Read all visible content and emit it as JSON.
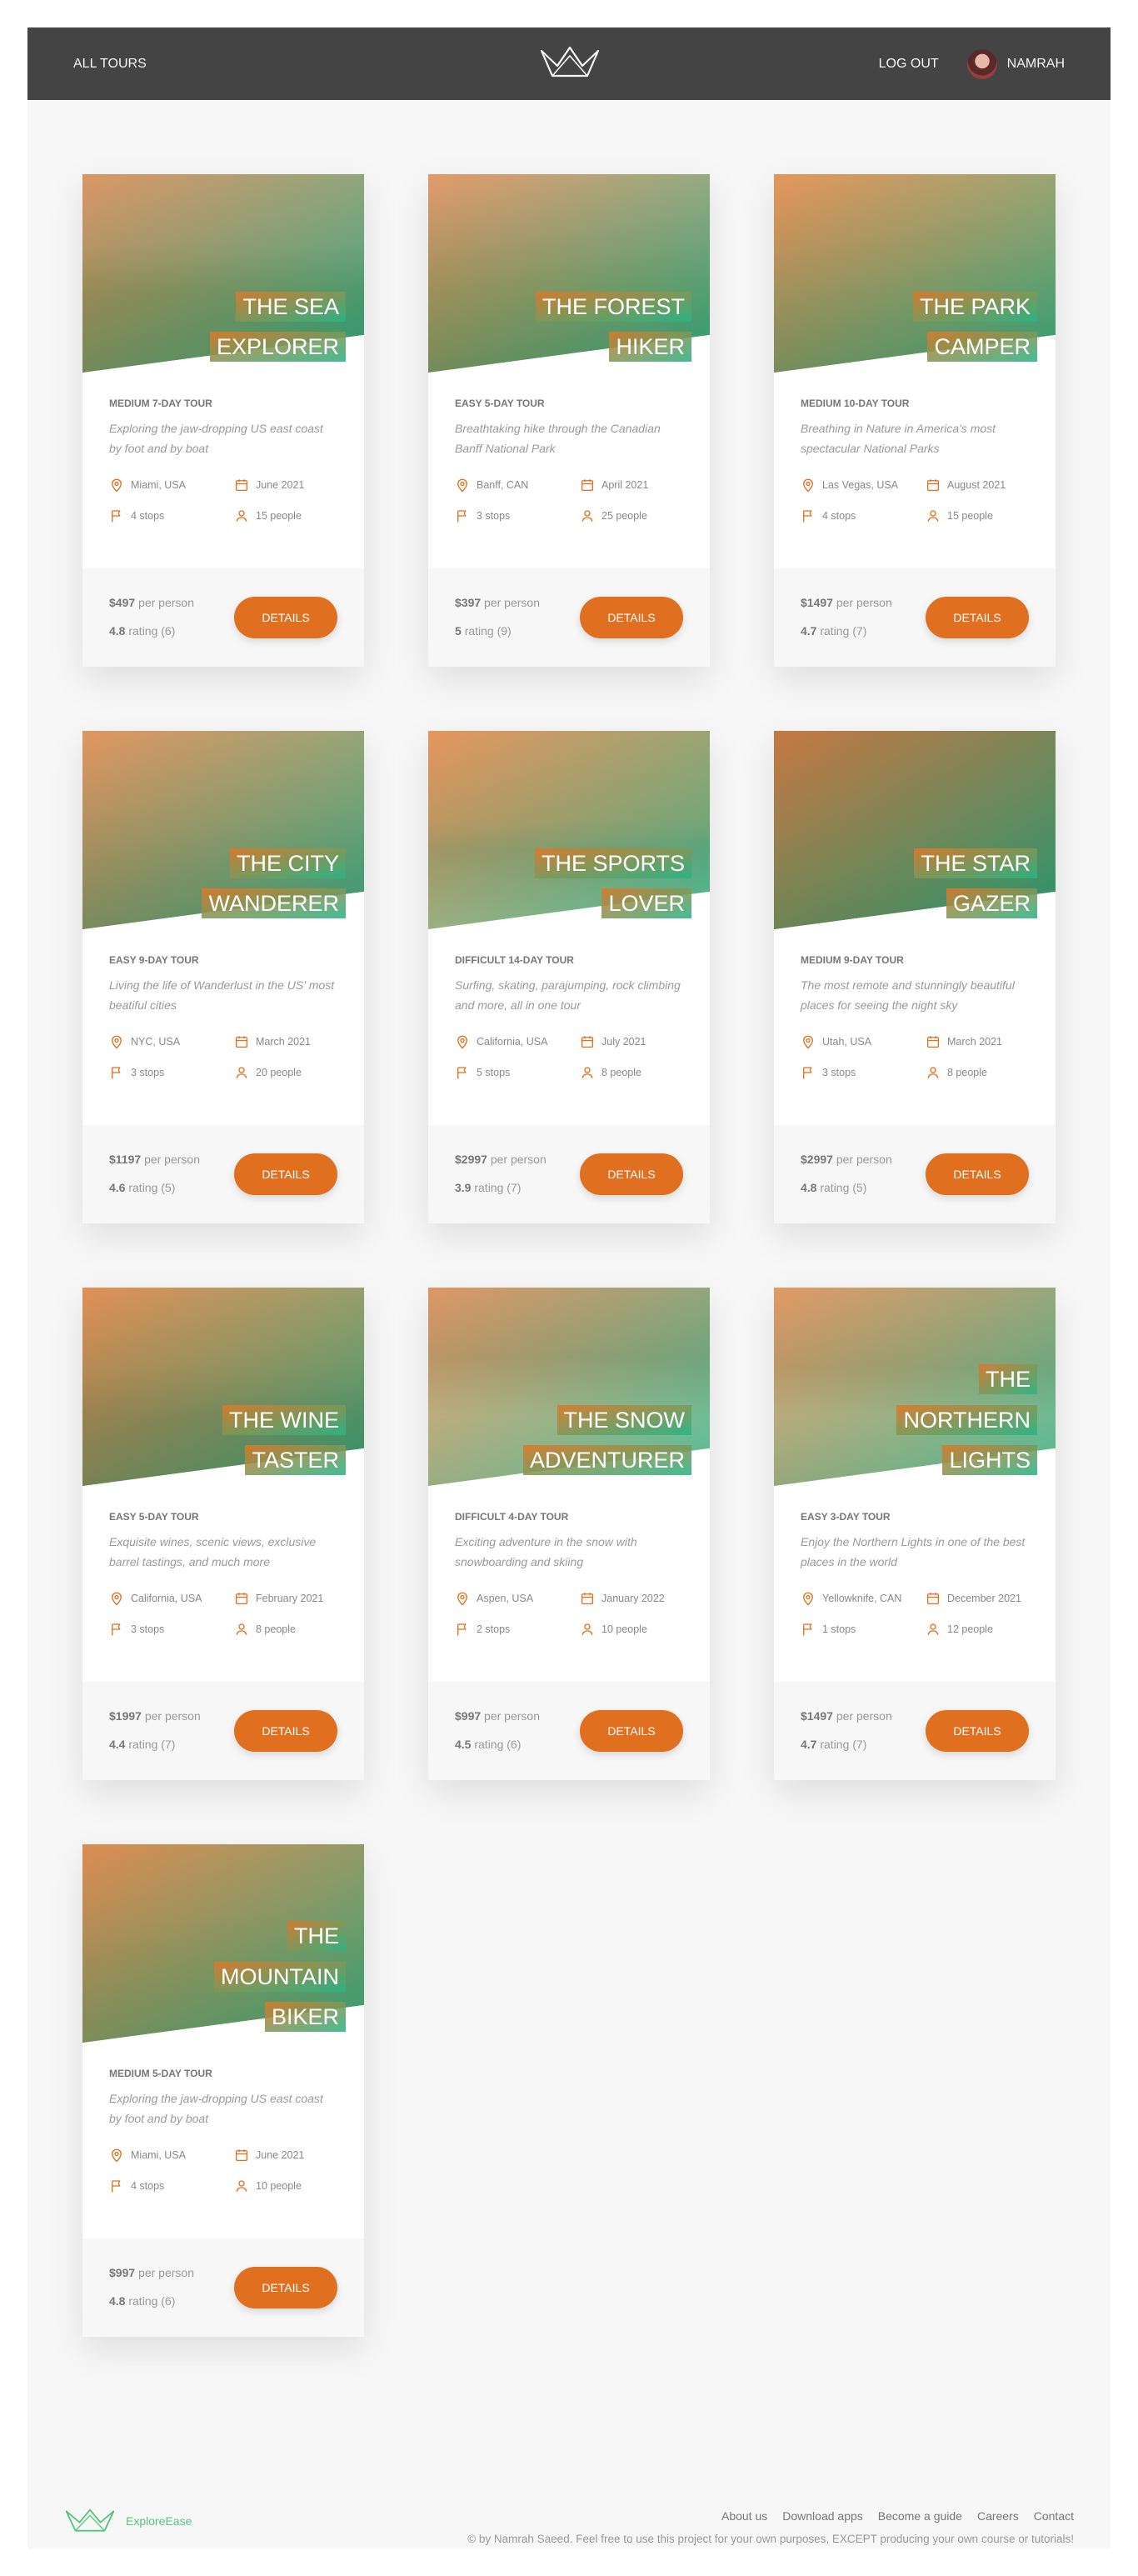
{
  "header": {
    "all_tours": "All tours",
    "logout": "Log out",
    "user_name": "NAMRAH",
    "logo_icon": "crown-logo-icon"
  },
  "colors": {
    "accent": "#e06f1f",
    "green": "#28b485",
    "header_bg": "#444444",
    "page_bg": "#f7f7f7"
  },
  "tours": [
    {
      "title": "The Sea Explorer",
      "title_lines": [
        "THE SEA",
        "EXPLORER"
      ],
      "difficulty_duration": "MEDIUM 7-DAY TOUR",
      "summary": "Exploring the jaw-dropping US east coast by foot and by boat",
      "location": "Miami, USA",
      "date": "June 2021",
      "stops": "4 stops",
      "people": "15 people",
      "price": "$497",
      "price_unit": "per person",
      "rating": "4.8",
      "rating_label": "rating (6)",
      "button": "DETAILS",
      "img_theme": "sea"
    },
    {
      "title": "The Forest Hiker",
      "title_lines": [
        "THE FOREST",
        "HIKER"
      ],
      "difficulty_duration": "EASY 5-DAY TOUR",
      "summary": "Breathtaking hike through the Canadian Banff National Park",
      "location": "Banff, CAN",
      "date": "April 2021",
      "stops": "3 stops",
      "people": "25 people",
      "price": "$397",
      "price_unit": "per person",
      "rating": "5",
      "rating_label": "rating (9)",
      "button": "DETAILS",
      "img_theme": "forest"
    },
    {
      "title": "The Park Camper",
      "title_lines": [
        "THE PARK",
        "CAMPER"
      ],
      "difficulty_duration": "MEDIUM 10-DAY TOUR",
      "summary": "Breathing in Nature in America's most spectacular National Parks",
      "location": "Las Vegas, USA",
      "date": "August 2021",
      "stops": "4 stops",
      "people": "15 people",
      "price": "$1497",
      "price_unit": "per person",
      "rating": "4.7",
      "rating_label": "rating (7)",
      "button": "DETAILS",
      "img_theme": "park"
    },
    {
      "title": "The City Wanderer",
      "title_lines": [
        "THE CITY",
        "WANDERER"
      ],
      "difficulty_duration": "EASY 9-DAY TOUR",
      "summary": "Living the life of Wanderlust in the US' most beatiful cities",
      "location": "NYC, USA",
      "date": "March 2021",
      "stops": "3 stops",
      "people": "20 people",
      "price": "$1197",
      "price_unit": "per person",
      "rating": "4.6",
      "rating_label": "rating (5)",
      "button": "DETAILS",
      "img_theme": "city"
    },
    {
      "title": "The Sports Lover",
      "title_lines": [
        "THE SPORTS",
        "LOVER"
      ],
      "difficulty_duration": "DIFFICULT 14-DAY TOUR",
      "summary": "Surfing, skating, parajumping, rock climbing and more, all in one tour",
      "location": "California, USA",
      "date": "July 2021",
      "stops": "5 stops",
      "people": "8 people",
      "price": "$2997",
      "price_unit": "per person",
      "rating": "3.9",
      "rating_label": "rating (7)",
      "button": "DETAILS",
      "img_theme": "sports"
    },
    {
      "title": "The Star Gazer",
      "title_lines": [
        "THE STAR",
        "GAZER"
      ],
      "difficulty_duration": "MEDIUM 9-DAY TOUR",
      "summary": "The most remote and stunningly beautiful places for seeing the night sky",
      "location": "Utah, USA",
      "date": "March 2021",
      "stops": "3 stops",
      "people": "8 people",
      "price": "$2997",
      "price_unit": "per person",
      "rating": "4.8",
      "rating_label": "rating (5)",
      "button": "DETAILS",
      "img_theme": "star"
    },
    {
      "title": "The Wine Taster",
      "title_lines": [
        "THE WINE",
        "TASTER"
      ],
      "difficulty_duration": "EASY 5-DAY TOUR",
      "summary": "Exquisite wines, scenic views, exclusive barrel tastings, and much more",
      "location": "California, USA",
      "date": "February 2021",
      "stops": "3 stops",
      "people": "8 people",
      "price": "$1997",
      "price_unit": "per person",
      "rating": "4.4",
      "rating_label": "rating (7)",
      "button": "DETAILS",
      "img_theme": "wine"
    },
    {
      "title": "The Snow Adventurer",
      "title_lines": [
        "THE SNOW",
        "ADVENTURER"
      ],
      "difficulty_duration": "DIFFICULT 4-DAY TOUR",
      "summary": "Exciting adventure in the snow with snowboarding and skiing",
      "location": "Aspen, USA",
      "date": "January 2022",
      "stops": "2 stops",
      "people": "10 people",
      "price": "$997",
      "price_unit": "per person",
      "rating": "4.5",
      "rating_label": "rating (6)",
      "button": "DETAILS",
      "img_theme": "snow"
    },
    {
      "title": "The Northern Lights",
      "title_lines": [
        "THE",
        "NORTHERN",
        "LIGHTS"
      ],
      "difficulty_duration": "EASY 3-DAY TOUR",
      "summary": "Enjoy the Northern Lights in one of the best places in the world",
      "location": "Yellowknife, CAN",
      "date": "December 2021",
      "stops": "1 stops",
      "people": "12 people",
      "price": "$1497",
      "price_unit": "per person",
      "rating": "4.7",
      "rating_label": "rating (7)",
      "button": "DETAILS",
      "img_theme": "northern"
    },
    {
      "title": "The Mountain Biker",
      "title_lines": [
        "THE",
        "MOUNTAIN",
        "BIKER"
      ],
      "difficulty_duration": "MEDIUM 5-DAY TOUR",
      "summary": "Exploring the jaw-dropping US east coast by foot and by boat",
      "location": "Miami, USA",
      "date": "June 2021",
      "stops": "4 stops",
      "people": "10 people",
      "price": "$997",
      "price_unit": "per person",
      "rating": "4.8",
      "rating_label": "rating (6)",
      "button": "DETAILS",
      "img_theme": "biker"
    }
  ],
  "footer": {
    "brand": "ExploreEase",
    "links": [
      "About us",
      "Download apps",
      "Become a guide",
      "Careers",
      "Contact"
    ],
    "copyright": "© by Namrah Saeed. Feel free to use this project for your own purposes, EXCEPT producing your own course or tutorials!"
  }
}
